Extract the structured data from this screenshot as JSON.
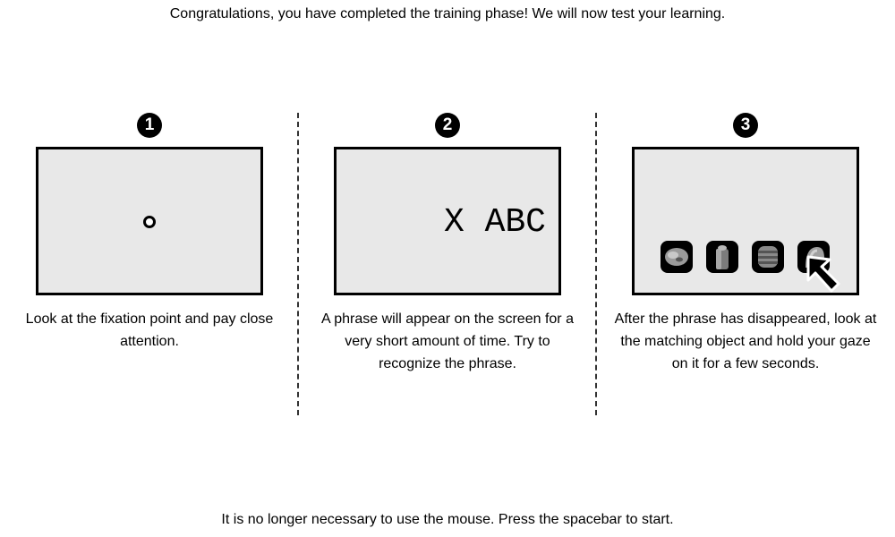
{
  "header": "Congratulations, you have completed the training phase! We will now test your learning.",
  "steps": [
    {
      "number": "1",
      "description": "Look at the fixation point and pay close attention."
    },
    {
      "number": "2",
      "description": "A phrase will appear on the screen for a very short amount of time. Try to recognize the phrase.",
      "phrase": "X ABC"
    },
    {
      "number": "3",
      "description": "After the phrase has disappeared, look at the matching object and hold your gaze on it for a few seconds."
    }
  ],
  "footer": "It is no longer necessary to use the mouse. Press the spacebar to start.",
  "icons": [
    "fixation-point-icon",
    "oval-object-icon",
    "cylinder-object-icon",
    "barrel-object-icon",
    "rounded-object-icon",
    "mouse-cursor-icon"
  ]
}
